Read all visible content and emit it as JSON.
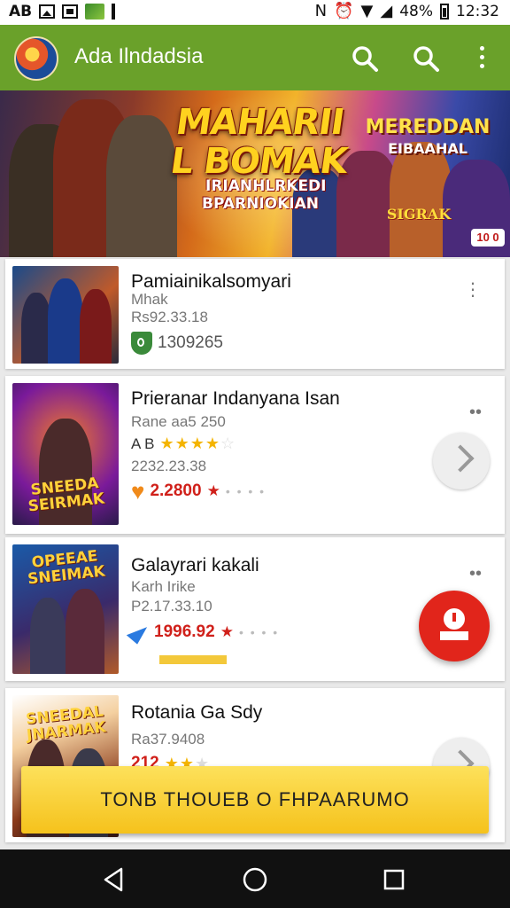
{
  "status_bar": {
    "left_text": "AB",
    "battery": "48%",
    "time": "12:32"
  },
  "app_bar": {
    "title": "Ada  Ilndadsia",
    "icons": [
      "search-icon",
      "search-icon",
      "more-vert-icon"
    ]
  },
  "banner": {
    "title_line1": "MAHARII",
    "title_line2": "L BOMAK",
    "sub_line1": "IRIANHLRKEDI",
    "sub_line2": "BPARNIOKIAN",
    "right_title": "MEREDDAN",
    "right_sub": "EIBAAHAL",
    "logo": "SIGRAK",
    "badge": "10 0"
  },
  "games": [
    {
      "title": "Pamiainikalsomyari",
      "line1": "Mhak",
      "line2": "Rs92.33.18",
      "price": "1309265",
      "price_style": "gray",
      "badge_icon": "shield-icon"
    },
    {
      "title": "Prieranar Indanyana Isan",
      "line1": "Rane aa5 250",
      "rating_prefix": "A B",
      "rating": 4,
      "line2": "2232.23.38",
      "price": "2.2800",
      "price_style": "red",
      "badge_icon": "heart-icon",
      "thumb_caption": "SNEEDA SEIRMAK"
    },
    {
      "title": "Galayrari kakali",
      "line1": "Karh Irike",
      "line2": "P2.17.33.10",
      "price": "1996.92",
      "price_style": "red",
      "badge_icon": "arrow-icon",
      "thumb_caption": "OPEEAE SNEIMAK"
    },
    {
      "title": "Rotania Ga Sdy",
      "line2": "Ra37.9408",
      "price": "212",
      "thumb_caption": "SNEEDAL JNARMAK"
    }
  ],
  "cta_label": "TONB THOUEB O FHPAARUMO",
  "colors": {
    "app_bar": "#6aa12a",
    "accent_red": "#e1251b",
    "cta_yellow": "#f5c21c",
    "star": "#f4b400"
  }
}
